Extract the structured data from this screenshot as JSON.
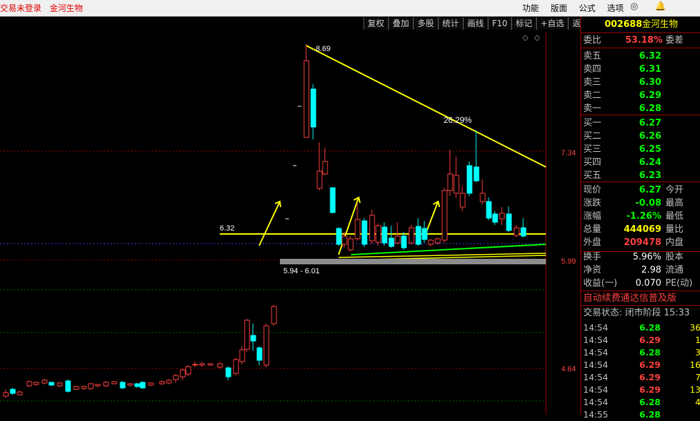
{
  "title_bar": {
    "status": "交易未登录",
    "stock_name": "金河生物"
  },
  "menu": [
    "功能",
    "版面",
    "公式",
    "选项"
  ],
  "window_icons": [
    "refresh-icon",
    "bell-icon"
  ],
  "window_icon_glyphs": [
    "◎",
    "🔔"
  ],
  "toolbar": [
    "复权",
    "叠加",
    "多股",
    "统计",
    "画线",
    "F10",
    "标记",
    "+自选",
    "返回"
  ],
  "chart": {
    "price_labels": [
      "7.34",
      "5.99",
      "4.64"
    ],
    "annotations": {
      "high_label": "8.69",
      "pct_label": "26.29%",
      "level_label": "6.32",
      "range_label": "5.94 - 6.01"
    },
    "colors": {
      "up": "#ff4040",
      "down": "#00ffff",
      "trend": "#ffff00",
      "support": "#00ff00"
    }
  },
  "quote": {
    "code": "002688",
    "name": "金河生物",
    "wei_bi": {
      "label": "委比",
      "value": "53.18%",
      "label2": "委差"
    },
    "asks": [
      {
        "label": "卖五",
        "price": "6.32"
      },
      {
        "label": "卖四",
        "price": "6.31"
      },
      {
        "label": "卖三",
        "price": "6.30"
      },
      {
        "label": "卖二",
        "price": "6.29"
      },
      {
        "label": "卖一",
        "price": "6.28"
      }
    ],
    "bids": [
      {
        "label": "买一",
        "price": "6.27"
      },
      {
        "label": "买二",
        "price": "6.26"
      },
      {
        "label": "买三",
        "price": "6.25"
      },
      {
        "label": "买四",
        "price": "6.24"
      },
      {
        "label": "买五",
        "price": "6.23"
      }
    ],
    "stats": [
      {
        "label": "现价",
        "value": "6.27",
        "color": "#00ff00",
        "label2": "今开"
      },
      {
        "label": "涨跌",
        "value": "-0.08",
        "color": "#00ff00",
        "label2": "最高"
      },
      {
        "label": "涨幅",
        "value": "-1.26%",
        "color": "#00ff00",
        "label2": "最低"
      },
      {
        "label": "总量",
        "value": "444069",
        "color": "#ffff00",
        "label2": "量比"
      },
      {
        "label": "外盘",
        "value": "209478",
        "color": "#ff4040",
        "label2": "内盘"
      }
    ],
    "stats2": [
      {
        "label": "换手",
        "value": "5.96%",
        "label2": "股本"
      },
      {
        "label": "净资",
        "value": "2.98",
        "label2": "流通"
      },
      {
        "label": "收益(一)",
        "value": "0.070",
        "label2": "PE(动)"
      }
    ],
    "notice": "自动续费通达信普及版 ",
    "trade_status": "交易状态: 闭市阶段 15:33",
    "ticks": [
      {
        "time": "14:54",
        "price": "6.28",
        "vol": "36"
      },
      {
        "time": "14:54",
        "price": "6.29",
        "vol": "1"
      },
      {
        "time": "14:54",
        "price": "6.28",
        "vol": "3"
      },
      {
        "time": "14:54",
        "price": "6.29",
        "vol": "16"
      },
      {
        "time": "14:54",
        "price": "6.29",
        "vol": "7"
      },
      {
        "time": "14:54",
        "price": "6.29",
        "vol": "13"
      },
      {
        "time": "14:54",
        "price": "6.28",
        "vol": "4"
      },
      {
        "time": "14:55",
        "price": "6.28",
        "vol": ""
      }
    ]
  }
}
